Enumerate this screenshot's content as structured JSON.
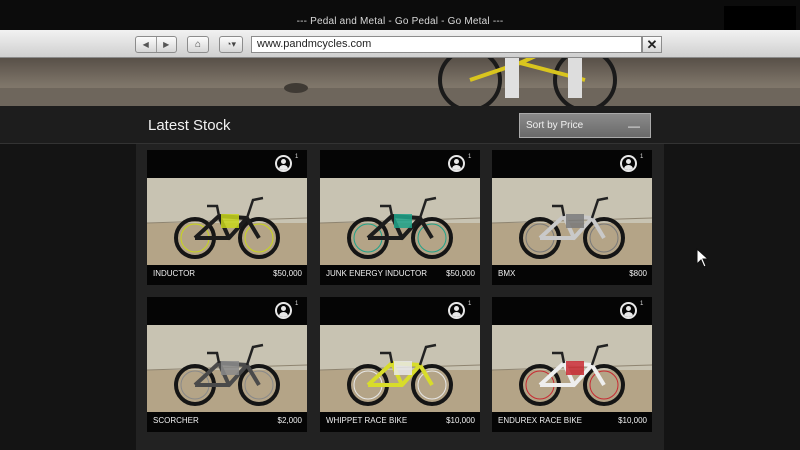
{
  "window": {
    "title": "--- Pedal and Metal - Go Pedal - Go Metal ---"
  },
  "browser": {
    "back_icon": "arrow-left-icon",
    "forward_icon": "arrow-right-icon",
    "home_icon": "home-icon",
    "history_icon": "clock-icon",
    "url": "www.pandmcycles.com",
    "close_label": "✕"
  },
  "page": {
    "heading": "Latest Stock",
    "sort": {
      "selected": "Sort by Price",
      "toggle": "—"
    }
  },
  "products": [
    {
      "name": "INDUCTOR",
      "price": "$50,000",
      "owners": "1",
      "frame": "#1c1c1c",
      "accent": "#c8d61c"
    },
    {
      "name": "JUNK ENERGY INDUCTOR",
      "price": "$50,000",
      "owners": "1",
      "frame": "#1c1c1c",
      "accent": "#1fa38a"
    },
    {
      "name": "BMX",
      "price": "$800",
      "owners": "1",
      "frame": "#c9c9c9",
      "accent": "#7a7a7a"
    },
    {
      "name": "SCORCHER",
      "price": "$2,000",
      "owners": "1",
      "frame": "#4a4a4a",
      "accent": "#8a8a8a"
    },
    {
      "name": "WHIPPET RACE BIKE",
      "price": "$10,000",
      "owners": "1",
      "frame": "#d8dc2a",
      "accent": "#e8e8e8"
    },
    {
      "name": "ENDUREX RACE BIKE",
      "price": "$10,000",
      "owners": "1",
      "frame": "#eeeeee",
      "accent": "#c82a32"
    }
  ]
}
